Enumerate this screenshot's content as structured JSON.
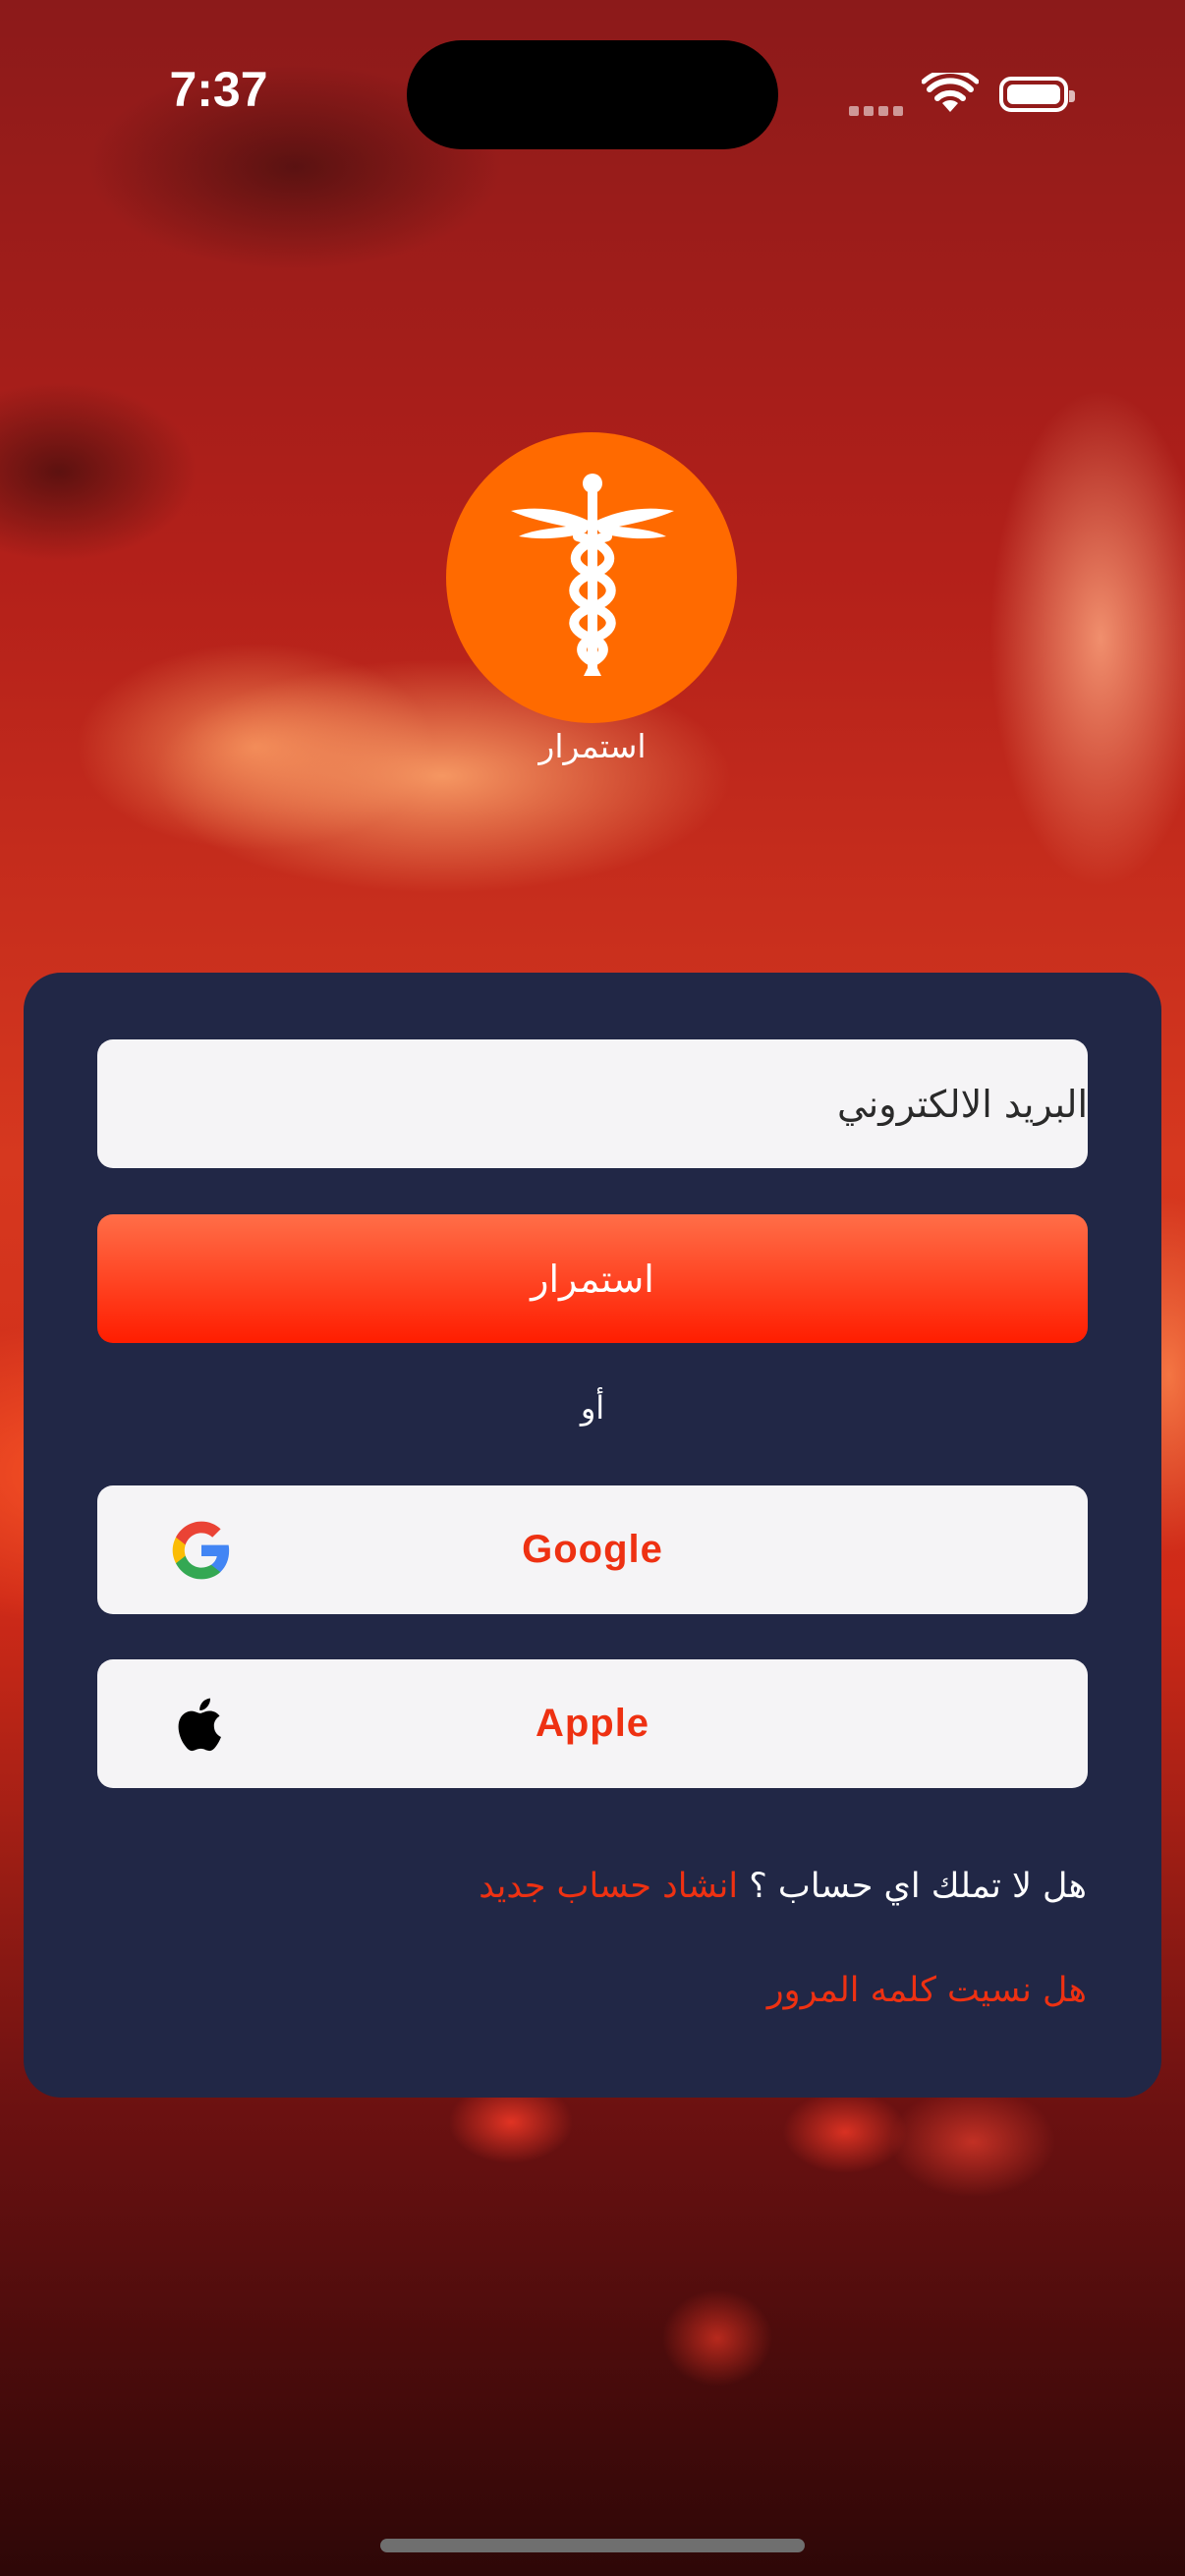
{
  "status_bar": {
    "time": "7:37"
  },
  "logo": {
    "icon": "caduceus-icon",
    "caption": "استمرار",
    "color": "#ff6a00"
  },
  "form": {
    "email_placeholder": "البريد الالكتروني",
    "continue_label": "استمرار",
    "or_label": "أو",
    "google_label": "Google",
    "google_icon": "google-icon",
    "apple_label": "Apple",
    "apple_icon": "apple-icon",
    "no_account_text": "هل لا تملك اي حساب ؟",
    "create_account_link": "انشاد حساب جديد",
    "forgot_password_link": "هل نسيت كلمه المرور"
  },
  "colors": {
    "card": "#212746",
    "accent": "#ee3112",
    "button_gradient_top": "#ff6e48",
    "button_gradient_bottom": "#ff1d00",
    "field_background": "#f5f4f6"
  }
}
